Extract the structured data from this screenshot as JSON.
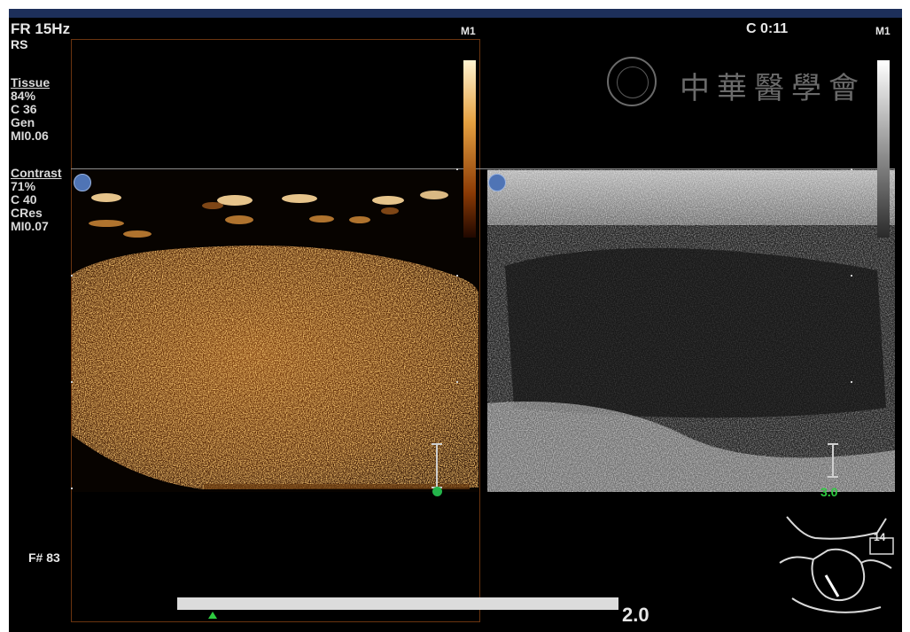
{
  "top_left": {
    "frame_rate": "FR 15Hz",
    "mode": "RS"
  },
  "tissue_block": {
    "title": "Tissue",
    "lines": [
      "84%",
      "C 36",
      "Gen",
      "MI0.06"
    ]
  },
  "contrast_block": {
    "title": "Contrast",
    "lines": [
      "71%",
      "C 40",
      "CRes",
      "MI0.07"
    ]
  },
  "marker_left": "M1",
  "marker_right": "M1",
  "timer": "C 0:11",
  "frame_number": "F# 83",
  "right_depth_label": "3.0",
  "bottom_value": "2.0",
  "probe_value": "14",
  "watermark_text": "中華醫學會",
  "colors": {
    "contrast": "#d98a2b",
    "tissue": "#9a9a9a",
    "background": "#000000",
    "accent_green": "#23b44a"
  }
}
